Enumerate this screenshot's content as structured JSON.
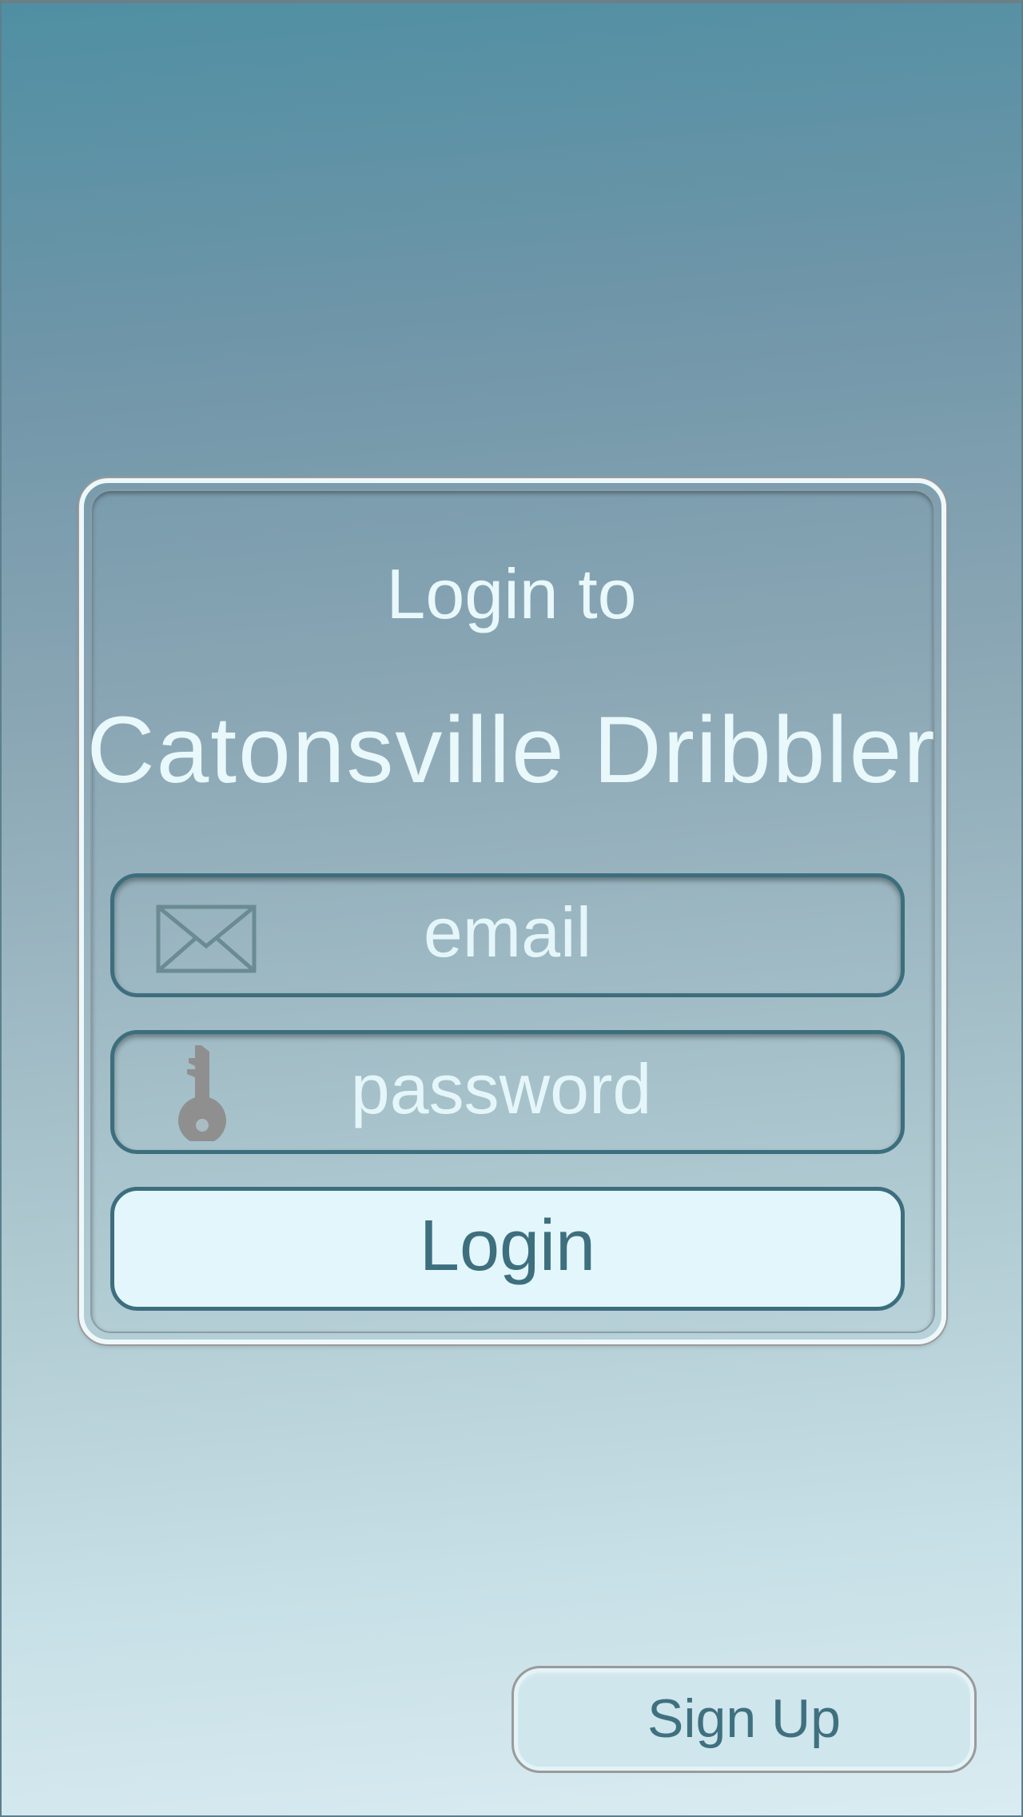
{
  "login_card": {
    "heading": "Login to",
    "app_name": "Catonsville Dribbler",
    "email_field": {
      "placeholder": "email",
      "icon": "mail-icon"
    },
    "password_field": {
      "placeholder": "password",
      "icon": "key-icon"
    },
    "login_label": "Login"
  },
  "signup_label": "Sign Up",
  "colors": {
    "accent": "#3d6e7d",
    "button_fill": "#e2f6fc",
    "text_light": "#e8f8fb",
    "icon_gray": "#8f8f8f"
  }
}
